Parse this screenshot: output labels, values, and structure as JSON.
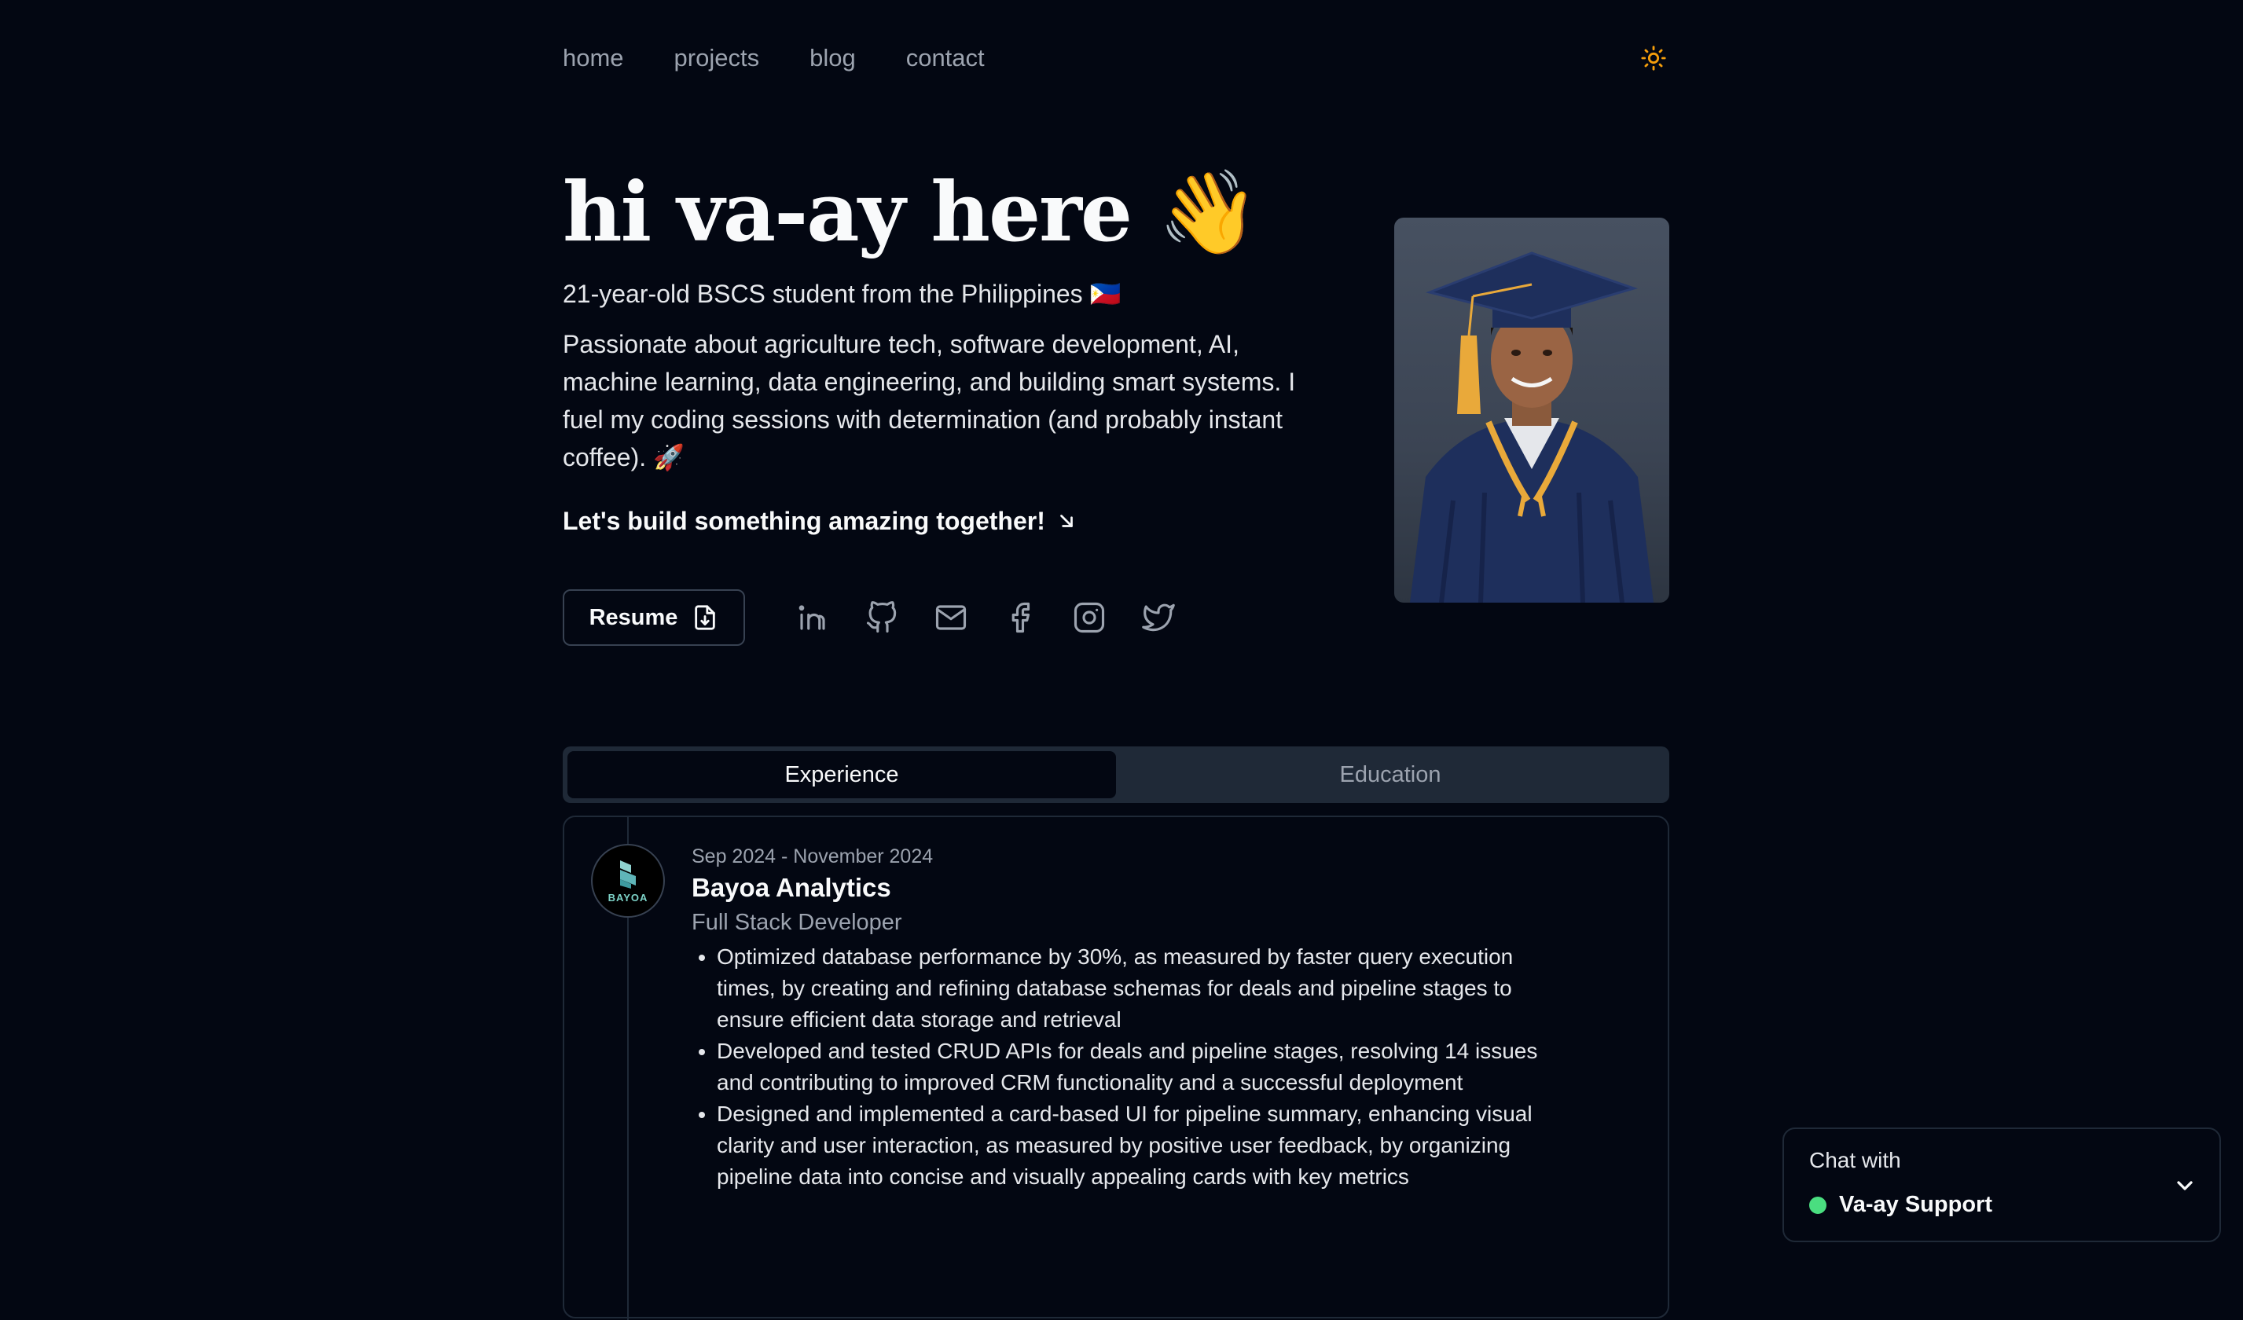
{
  "nav": {
    "links": [
      "home",
      "projects",
      "blog",
      "contact"
    ],
    "theme_icon": "sun-icon"
  },
  "hero": {
    "title": "hi va-ay here 👋",
    "subtitle": "21-year-old BSCS student from the Philippines 🇵🇭",
    "description": "Passionate about agriculture tech, software development, AI, machine learning, data engineering, and building smart systems. I fuel my coding sessions with determination (and probably instant coffee). 🚀",
    "cta": "Let's build something amazing together!",
    "resume_label": "Resume",
    "socials": [
      "linkedin-icon",
      "github-icon",
      "mail-icon",
      "facebook-icon",
      "instagram-icon",
      "twitter-icon"
    ]
  },
  "tabs": {
    "experience": "Experience",
    "education": "Education",
    "active": "Experience"
  },
  "experience": [
    {
      "logo_text": "BAYOA",
      "date": "Sep 2024 - November 2024",
      "company": "Bayoa Analytics",
      "role": "Full Stack Developer",
      "bullets": [
        "Optimized database performance by 30%, as measured by faster query execution times, by creating and refining database schemas for deals and pipeline stages to ensure efficient data storage and retrieval",
        "Developed and tested CRUD APIs for deals and pipeline stages, resolving 14 issues and contributing to improved CRM functionality and a successful deployment",
        "Designed and implemented a card-based UI for pipeline summary, enhancing visual clarity and user interaction, as measured by positive user feedback, by organizing pipeline data into concise and visually appealing cards with key metrics"
      ]
    }
  ],
  "chat": {
    "label": "Chat with",
    "agent": "Va-ay Support",
    "status_color": "#4ade80"
  },
  "colors": {
    "background": "#030712",
    "border": "#1f2937",
    "muted_text": "#9ca3af",
    "theme_icon": "#f59e0b"
  }
}
